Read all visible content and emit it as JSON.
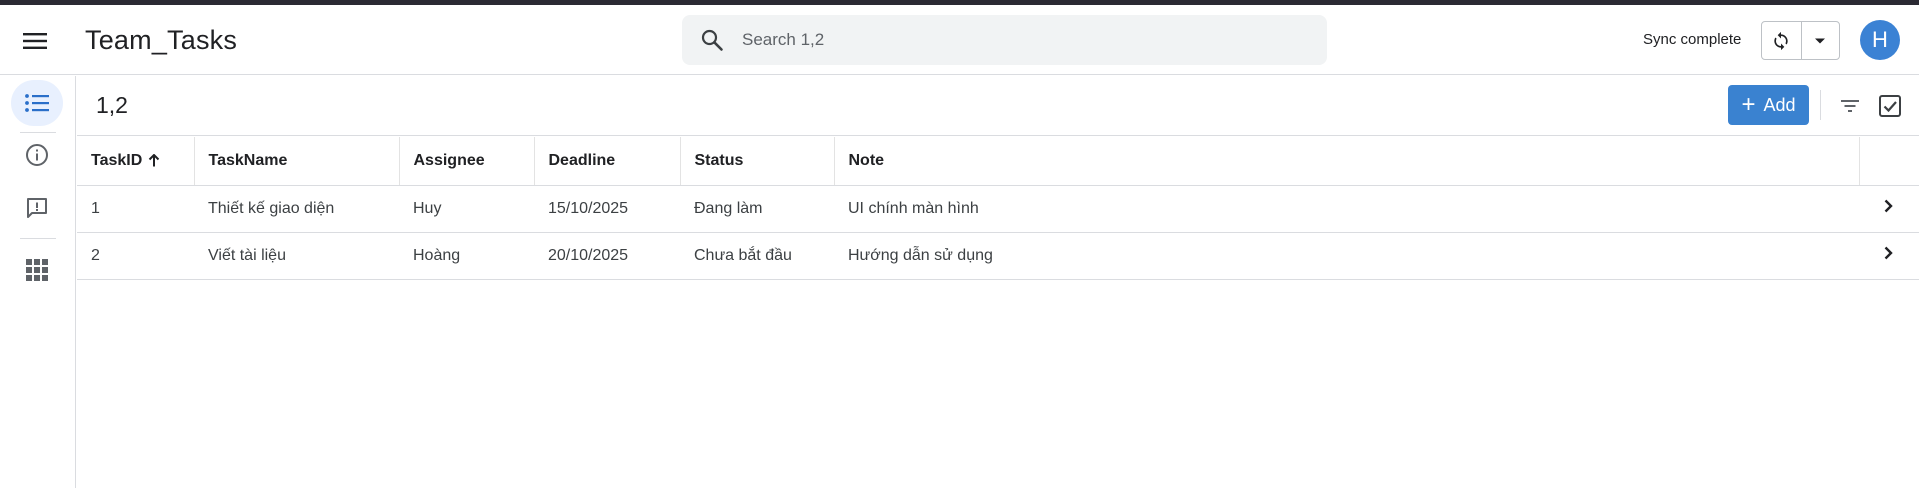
{
  "header": {
    "app_title": "Team_Tasks",
    "search_placeholder": "Search 1,2",
    "sync_status": "Sync complete",
    "avatar_initial": "H"
  },
  "sidebar": {
    "items": [
      {
        "icon": "list-icon",
        "active": true
      },
      {
        "icon": "info-icon",
        "active": false
      },
      {
        "icon": "feedback-icon",
        "active": false
      },
      {
        "icon": "apps-grid-icon",
        "active": false
      }
    ]
  },
  "view": {
    "title": "1,2",
    "add_label": "Add"
  },
  "table": {
    "columns": [
      "TaskID",
      "TaskName",
      "Assignee",
      "Deadline",
      "Status",
      "Note"
    ],
    "sorted_column": "TaskID",
    "sort_direction": "ascending",
    "rows": [
      {
        "TaskID": "1",
        "TaskName": "Thiết kế giao diện",
        "Assignee": "Huy",
        "Deadline": "15/10/2025",
        "Status": "Đang làm",
        "Note": "UI chính màn hình"
      },
      {
        "TaskID": "2",
        "TaskName": "Viết tài liệu",
        "Assignee": "Hoàng",
        "Deadline": "20/10/2025",
        "Status": "Chưa bắt đầu",
        "Note": "Hướng dẫn sử dụng"
      }
    ]
  },
  "colors": {
    "accent": "#3a82d0",
    "avatar": "#3b82d4",
    "active_nav_bg": "#e8f0fe",
    "top_strip": "#2b2a33"
  }
}
